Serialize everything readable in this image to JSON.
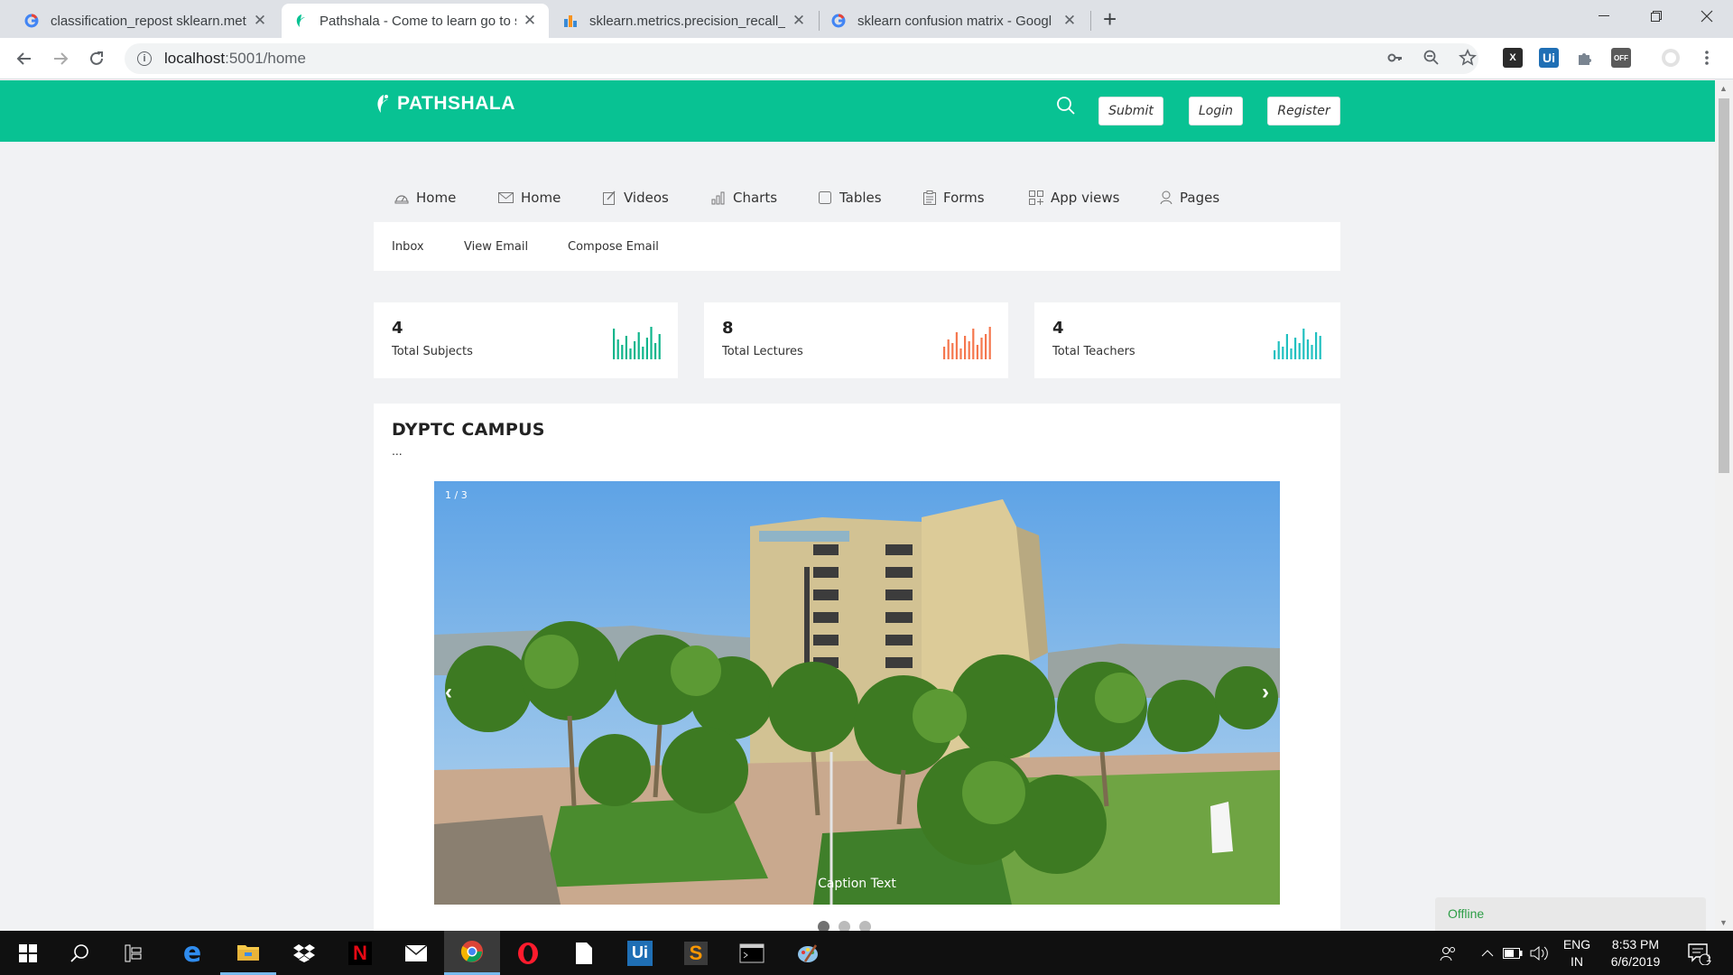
{
  "browser": {
    "tabs": [
      {
        "title": "classification_repost sklearn.metr",
        "favicon": "google-g-icon",
        "active": false
      },
      {
        "title": "Pathshala - Come to learn go to s",
        "favicon": "pathshala-leaf-icon",
        "active": true
      },
      {
        "title": "sklearn.metrics.precision_recall_fs",
        "favicon": "chart-bars-icon",
        "active": false
      },
      {
        "title": "sklearn confusion matrix - Googl",
        "favicon": "google-g-icon",
        "active": false
      }
    ],
    "url_host": "localhost",
    "url_path": ":5001/home",
    "extensions": [
      "key-icon",
      "zoom-out-icon",
      "star-icon",
      "x-extension-icon",
      "ui-extension-icon",
      "puzzle-icon",
      "off-extension-icon",
      "profile-icon",
      "menu-dots-icon"
    ]
  },
  "site": {
    "brand": "PATHSHALA",
    "colors": {
      "primary": "#08c293",
      "bars_green": "#0fb58c",
      "bars_orange": "#f5774e",
      "bars_teal": "#20c0c0"
    },
    "header_buttons": {
      "submit": "Submit",
      "login": "Login",
      "register": "Register"
    },
    "menu": [
      "Home",
      "Home",
      "Videos",
      "Charts",
      "Tables",
      "Forms",
      "App views",
      "Pages"
    ],
    "submenu": [
      "Inbox",
      "View Email",
      "Compose Email"
    ],
    "stats": [
      {
        "value": "4",
        "label": "Total Subjects",
        "color": "#0fb58c"
      },
      {
        "value": "8",
        "label": "Total Lectures",
        "color": "#f5774e"
      },
      {
        "value": "4",
        "label": "Total Teachers",
        "color": "#20c0c0"
      }
    ],
    "campus": {
      "title": "DYPTC CAMPUS",
      "subtitle": "...",
      "slide_counter": "1 / 3",
      "caption": "Caption Text",
      "prev": "‹",
      "next": "›"
    },
    "offline_label": "Offline"
  },
  "taskbar": {
    "apps": [
      "windows-start-icon",
      "search-icon",
      "task-view-icon",
      "edge-icon",
      "file-explorer-icon",
      "dropbox-icon",
      "netflix-icon",
      "mail-icon",
      "chrome-icon",
      "opera-icon",
      "file-icon",
      "uipath-icon",
      "sublime-icon",
      "terminal-icon",
      "paint-icon"
    ],
    "lang_1": "ENG",
    "lang_2": "IN",
    "time": "8:53 PM",
    "date": "6/6/2019",
    "notification_count": "1"
  }
}
